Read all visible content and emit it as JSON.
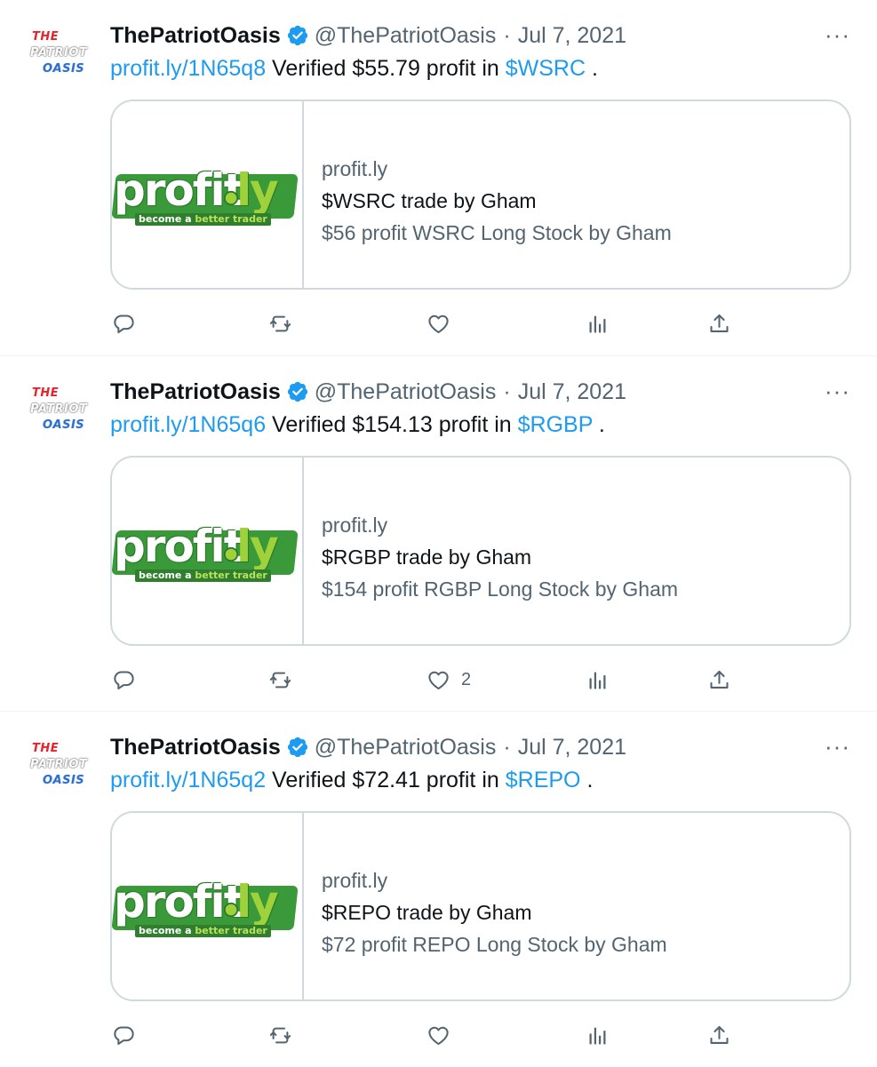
{
  "colors": {
    "link": "#1d9bf0",
    "secondary_text": "#536471",
    "primary_text": "#0f1419",
    "border": "#cfd9de",
    "verified_badge": "#1d9bf0",
    "logo_green": "#3a9a3a"
  },
  "icons": {
    "more": "more-horizontal-icon",
    "verified": "verified-badge-icon",
    "reply": "reply-icon",
    "retweet": "retweet-icon",
    "like": "heart-icon",
    "views": "views-icon",
    "share": "share-icon"
  },
  "tweets": [
    {
      "avatar_lines": [
        "THE",
        "PATRIOT",
        "OASIS"
      ],
      "name": "ThePatriotOasis",
      "handle": "@ThePatriotOasis",
      "separator": "·",
      "date": "Jul 7, 2021",
      "more": "···",
      "link": "profit.ly/1N65q8",
      "text_middle": " Verified $55.79 profit in ",
      "ticker": "$WSRC",
      "text_end": " .",
      "card": {
        "logo_word": "profit",
        "logo_ly": "ly",
        "logo_tag_a": "become a ",
        "logo_tag_b": "better trader",
        "domain": "profit.ly",
        "title": "$WSRC trade by Gham",
        "description": "$56 profit WSRC Long Stock by Gham"
      },
      "like_count": ""
    },
    {
      "avatar_lines": [
        "THE",
        "PATRIOT",
        "OASIS"
      ],
      "name": "ThePatriotOasis",
      "handle": "@ThePatriotOasis",
      "separator": "·",
      "date": "Jul 7, 2021",
      "more": "···",
      "link": "profit.ly/1N65q6",
      "text_middle": " Verified $154.13 profit in ",
      "ticker": "$RGBP",
      "text_end": " .",
      "card": {
        "logo_word": "profit",
        "logo_ly": "ly",
        "logo_tag_a": "become a ",
        "logo_tag_b": "better trader",
        "domain": "profit.ly",
        "title": "$RGBP trade by Gham",
        "description": "$154 profit RGBP Long Stock by Gham"
      },
      "like_count": "2"
    },
    {
      "avatar_lines": [
        "THE",
        "PATRIOT",
        "OASIS"
      ],
      "name": "ThePatriotOasis",
      "handle": "@ThePatriotOasis",
      "separator": "·",
      "date": "Jul 7, 2021",
      "more": "···",
      "link": "profit.ly/1N65q2",
      "text_middle": " Verified $72.41 profit in ",
      "ticker": "$REPO",
      "text_end": " .",
      "card": {
        "logo_word": "profit",
        "logo_ly": "ly",
        "logo_tag_a": "become a ",
        "logo_tag_b": "better trader",
        "domain": "profit.ly",
        "title": "$REPO trade by Gham",
        "description": "$72 profit REPO Long Stock by Gham"
      },
      "like_count": ""
    }
  ]
}
